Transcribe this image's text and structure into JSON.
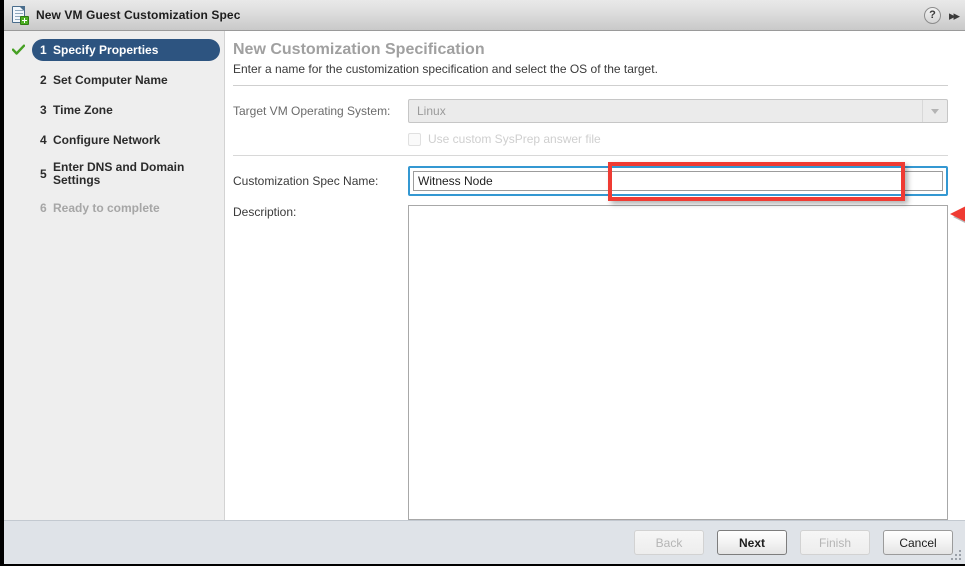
{
  "window": {
    "title": "New VM Guest Customization Spec",
    "icon": "new-document-icon",
    "help_label": "?",
    "collapse_label": "▶▶"
  },
  "sidebar": {
    "steps": [
      {
        "num": "1",
        "label": "Specify Properties",
        "state": "active",
        "completed": true
      },
      {
        "num": "2",
        "label": "Set Computer Name",
        "state": "default",
        "completed": false
      },
      {
        "num": "3",
        "label": "Time Zone",
        "state": "default",
        "completed": false
      },
      {
        "num": "4",
        "label": "Configure Network",
        "state": "default",
        "completed": false
      },
      {
        "num": "5",
        "label": "Enter DNS and Domain Settings",
        "state": "default",
        "completed": false
      },
      {
        "num": "6",
        "label": "Ready to complete",
        "state": "disabled",
        "completed": false
      }
    ]
  },
  "main": {
    "heading": "New Customization Specification",
    "subheading": "Enter a name for the customization specification and select the OS of the target.",
    "os_row": {
      "label": "Target VM Operating System:",
      "selected_value": "Linux",
      "options": [
        "Linux"
      ],
      "disabled": true
    },
    "sysprep_row": {
      "label": "Use custom SysPrep answer file",
      "checked": false,
      "disabled": true
    },
    "name_row": {
      "label": "Customization Spec Name:",
      "value": "Witness Node",
      "placeholder": "",
      "focused": true
    },
    "description_row": {
      "label": "Description:",
      "value": "",
      "placeholder": ""
    }
  },
  "footer": {
    "buttons": [
      {
        "label": "Back",
        "state": "disabled"
      },
      {
        "label": "Next",
        "state": "primary"
      },
      {
        "label": "Finish",
        "state": "disabled"
      },
      {
        "label": "Cancel",
        "state": "default"
      }
    ]
  },
  "annotations": {
    "highlight_color": "#ef3b33",
    "focus_color": "#3498d2",
    "accent_color": "#2d5480"
  }
}
